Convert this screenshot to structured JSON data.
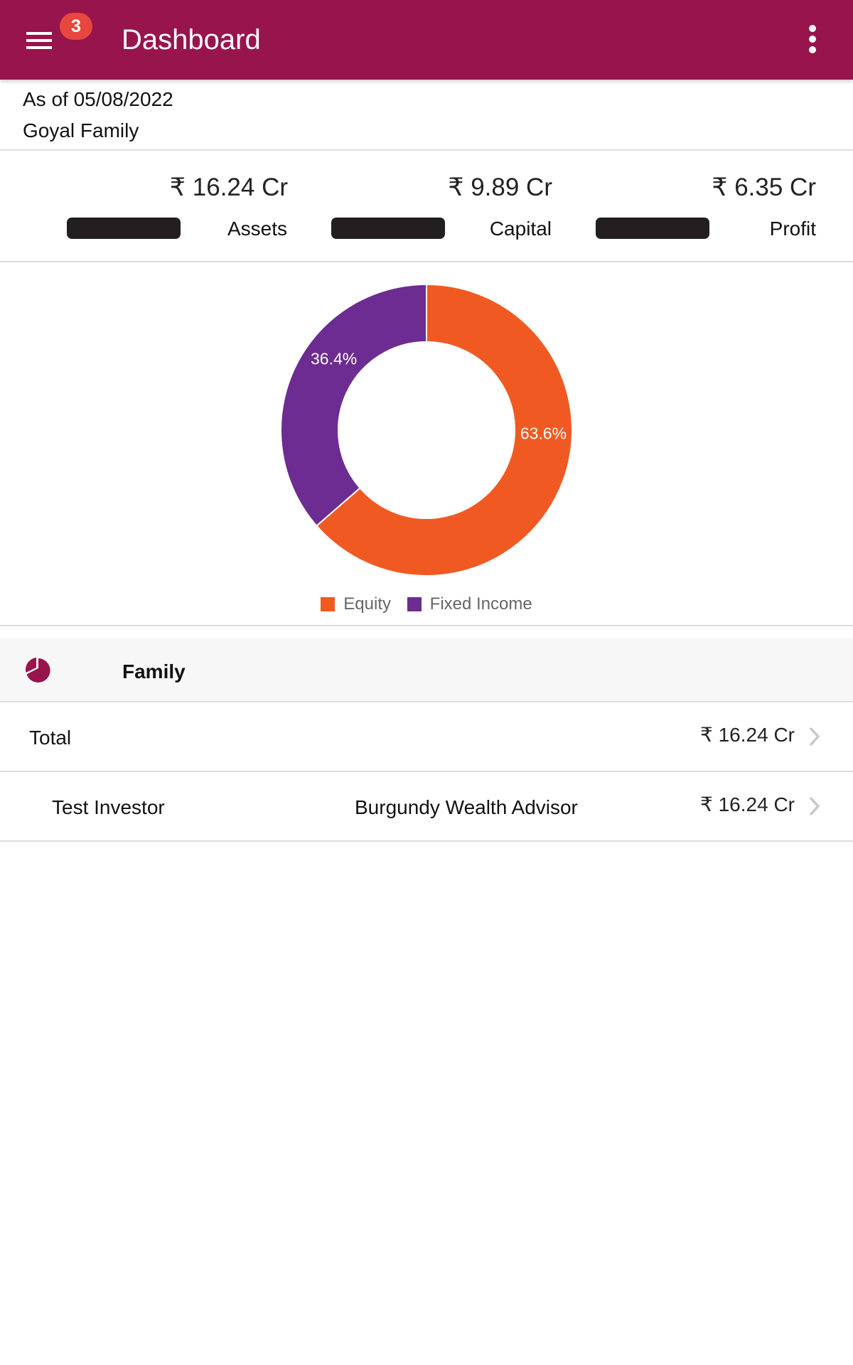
{
  "appbar": {
    "title": "Dashboard",
    "notification_count": "3",
    "background_color": "#98144d",
    "badge_color": "#e8473f"
  },
  "summary": {
    "as_of": "As of 05/08/2022",
    "family_name": "Goyal Family",
    "metrics": [
      {
        "value": "₹ 16.24 Cr",
        "label": "Assets"
      },
      {
        "value": "₹ 9.89 Cr",
        "label": "Capital"
      },
      {
        "value": "₹ 6.35 Cr",
        "label": "Profit"
      }
    ]
  },
  "chart_data": {
    "type": "pie",
    "variant": "donut",
    "title": "",
    "slices": [
      {
        "label": "Equity",
        "value": 63.6,
        "display": "63.6%",
        "color": "#f05a22"
      },
      {
        "label": "Fixed Income",
        "value": 36.4,
        "display": "36.4%",
        "color": "#6c2c91"
      }
    ],
    "legend": [
      "Equity",
      "Fixed Income"
    ],
    "legend_position": "bottom"
  },
  "section": {
    "title": "Family",
    "icon": "pie-chart-icon"
  },
  "rows": [
    {
      "label": "Total",
      "advisor": "",
      "amount": "₹ 16.24 Cr"
    },
    {
      "label": "Test Investor",
      "advisor": "Burgundy Wealth Advisor",
      "amount": "₹ 16.24 Cr"
    }
  ]
}
